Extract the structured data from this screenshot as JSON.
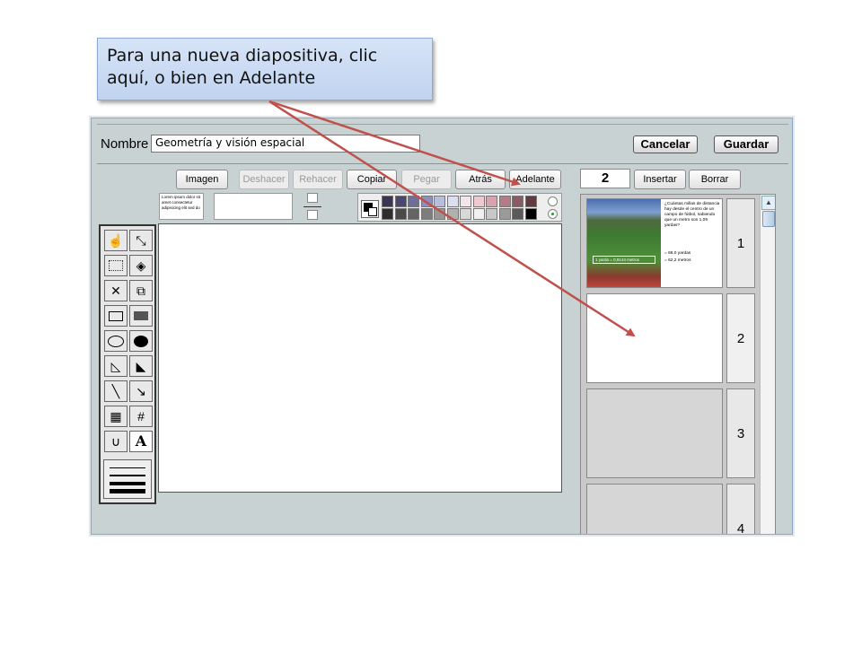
{
  "callout": {
    "text": "Para una nueva diapositiva, clic aquí, o bien en Adelante"
  },
  "header": {
    "name_label": "Nombre",
    "name_value": "Geometría y visión espacial",
    "cancel_label": "Cancelar",
    "save_label": "Guardar"
  },
  "toolbar": {
    "image": "Imagen",
    "undo": "Deshacer",
    "redo": "Rehacer",
    "copy": "Copiar",
    "paste": "Pegar",
    "back": "Atrás",
    "forward": "Adelante",
    "slide_number": "2",
    "insert": "Insertar",
    "delete": "Borrar"
  },
  "text_sample": "Lorem ipsum dolor sit amet consectetur adipisicing elit sed do",
  "palette": {
    "row1": [
      "#3a3550",
      "#4a4870",
      "#6e6f9a",
      "#8d8fc0",
      "#b8bde0",
      "#dcdff2",
      "#f2e6ec",
      "#efc8d0",
      "#d9a3ad",
      "#b57c86",
      "#8c5a62",
      "#5e3c40"
    ],
    "row2": [
      "#2e2e2e",
      "#4a4a4a",
      "#646464",
      "#7d7d7d",
      "#969696",
      "#b0b0b0",
      "#d8d8d8",
      "#f0f0f0",
      "#c8c8c8",
      "#9a9a9a",
      "#5a5a5a",
      "#000000"
    ]
  },
  "tools": {
    "text_tool": "A"
  },
  "slides": {
    "numbers": [
      "1",
      "2",
      "3",
      "4"
    ],
    "slide1": {
      "question": "¿Cuántas millas de distancia hay desde el centro de un campo de fútbol, sabiendo que un metro son 1,09 yardas?",
      "caption": "1 yarda = 0,9144 metros",
      "answer1": "= 68,0 yardas",
      "answer2": "= 62,2 metros"
    }
  },
  "colors": {
    "frame_bg": "#c9d2d3",
    "callout_bg": "#c9daf3",
    "arrow": "#c0504d"
  }
}
